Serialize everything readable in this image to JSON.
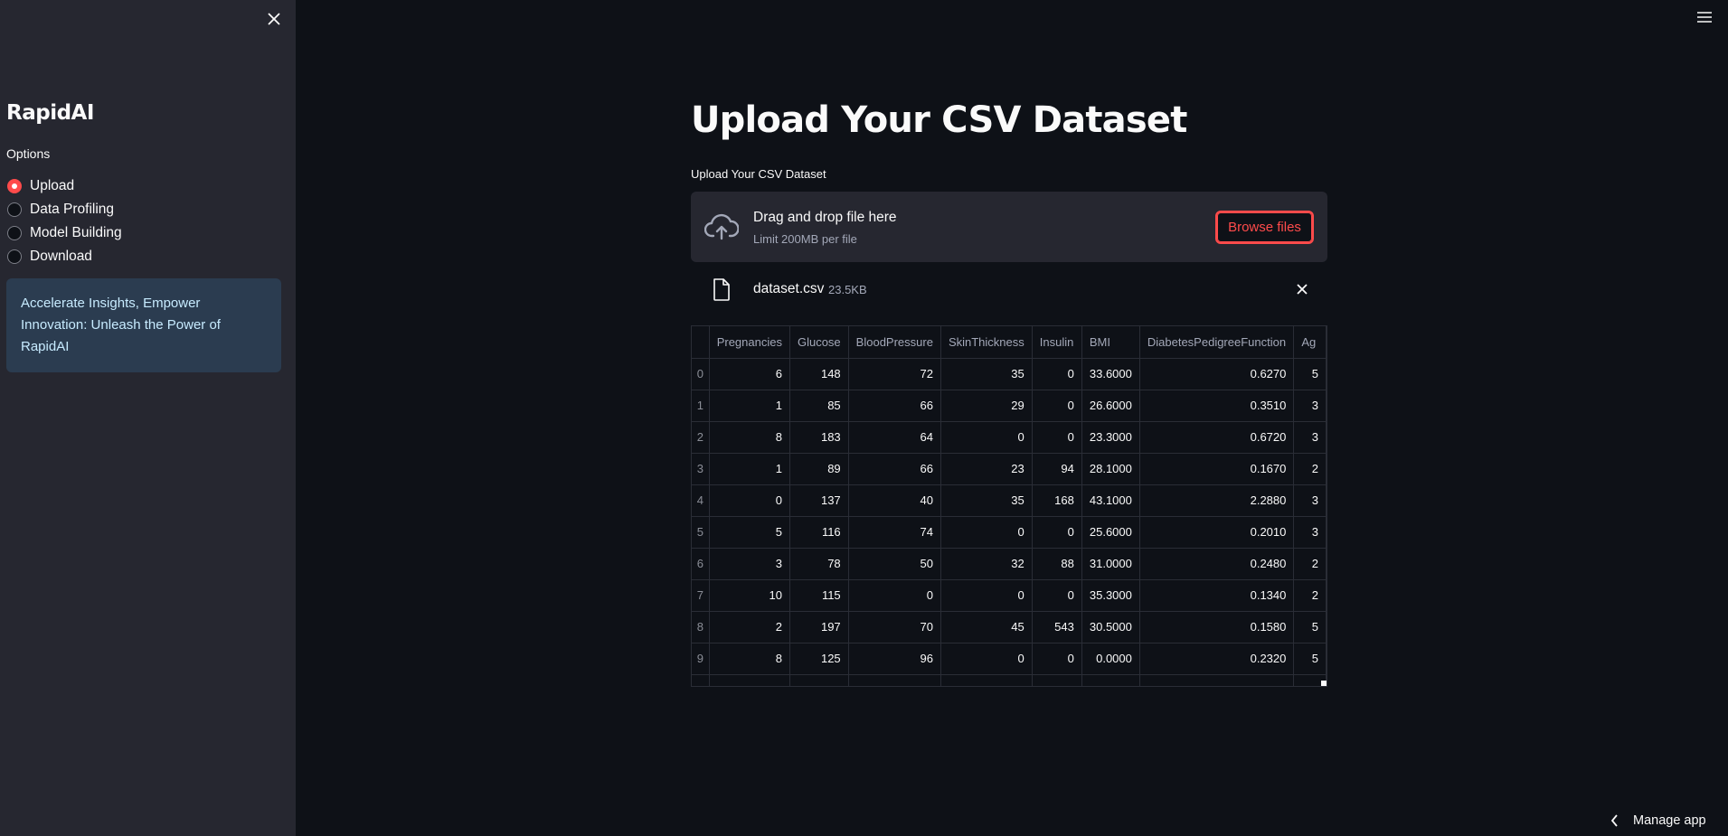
{
  "sidebar": {
    "app_title": "RapidAI",
    "options_label": "Options",
    "radio_options": [
      {
        "label": "Upload",
        "selected": true
      },
      {
        "label": "Data Profiling",
        "selected": false
      },
      {
        "label": "Model Building",
        "selected": false
      },
      {
        "label": "Download",
        "selected": false
      }
    ],
    "info_text": "Accelerate Insights, Empower Innovation: Unleash the Power of RapidAI"
  },
  "main": {
    "title": "Upload Your CSV Dataset",
    "uploader": {
      "label": "Upload Your CSV Dataset",
      "drop_title": "Drag and drop file here",
      "limit_text": "Limit 200MB per file",
      "browse_label": "Browse files"
    },
    "file": {
      "name": "dataset.csv",
      "size": "23.5KB"
    },
    "table": {
      "columns": [
        "",
        "Pregnancies",
        "Glucose",
        "BloodPressure",
        "SkinThickness",
        "Insulin",
        "BMI",
        "DiabetesPedigreeFunction",
        "Ag"
      ],
      "rows": [
        [
          "0",
          "6",
          "148",
          "72",
          "35",
          "0",
          "33.6000",
          "0.6270",
          "5"
        ],
        [
          "1",
          "1",
          "85",
          "66",
          "29",
          "0",
          "26.6000",
          "0.3510",
          "3"
        ],
        [
          "2",
          "8",
          "183",
          "64",
          "0",
          "0",
          "23.3000",
          "0.6720",
          "3"
        ],
        [
          "3",
          "1",
          "89",
          "66",
          "23",
          "94",
          "28.1000",
          "0.1670",
          "2"
        ],
        [
          "4",
          "0",
          "137",
          "40",
          "35",
          "168",
          "43.1000",
          "2.2880",
          "3"
        ],
        [
          "5",
          "5",
          "116",
          "74",
          "0",
          "0",
          "25.6000",
          "0.2010",
          "3"
        ],
        [
          "6",
          "3",
          "78",
          "50",
          "32",
          "88",
          "31.0000",
          "0.2480",
          "2"
        ],
        [
          "7",
          "10",
          "115",
          "0",
          "0",
          "0",
          "35.3000",
          "0.1340",
          "2"
        ],
        [
          "8",
          "2",
          "197",
          "70",
          "45",
          "543",
          "30.5000",
          "0.1580",
          "5"
        ],
        [
          "9",
          "8",
          "125",
          "96",
          "0",
          "0",
          "0.0000",
          "0.2320",
          "5"
        ],
        [
          "",
          "",
          "",
          "",
          "",
          "",
          "",
          "",
          ""
        ]
      ]
    }
  },
  "footer": {
    "manage_app_label": "Manage app"
  },
  "colors": {
    "background": "#0e1117",
    "sidebar": "#262730",
    "accent": "#ff4b4b",
    "info_bg": "#2b3c50",
    "info_text": "#c7ebff"
  },
  "icons": {
    "sidebar_close": "close-icon",
    "menu": "hamburger-menu-icon",
    "upload": "cloud-upload-icon",
    "file": "file-icon",
    "remove": "close-icon",
    "manage_app": "chevron-left-icon"
  }
}
